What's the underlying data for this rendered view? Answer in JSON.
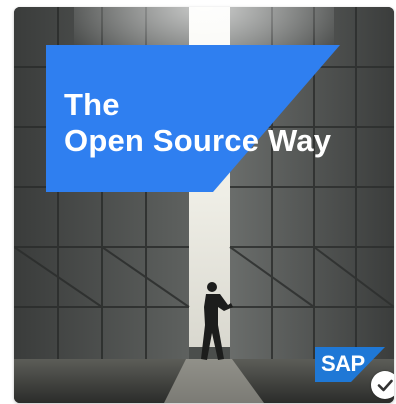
{
  "tile": {
    "title_line1": "The",
    "title_line2": "Open Source Way",
    "brand_logo_text": "SAP"
  },
  "colors": {
    "banner": "#2f7ff0",
    "logo_blue": "#1f78d6",
    "title_text": "#ffffff"
  },
  "icons": {
    "photo": "hangar-door-photo",
    "badge": "check-icon"
  }
}
